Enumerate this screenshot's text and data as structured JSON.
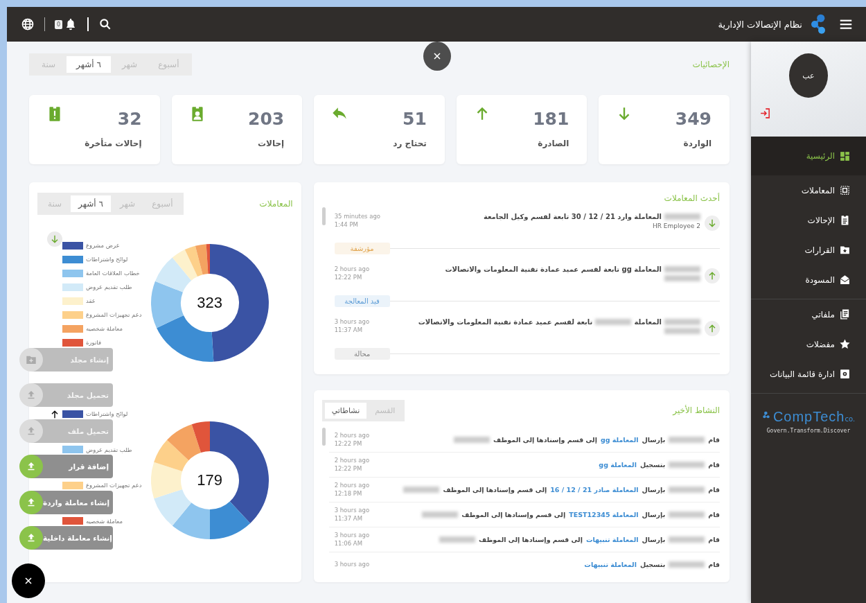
{
  "app": {
    "title": "نظام الإتصالات الإدارية",
    "notification_count": "0"
  },
  "stats": {
    "title": "الإحصائيات",
    "periods": [
      {
        "label": "أسبوع",
        "selected": false
      },
      {
        "label": "شهر",
        "selected": false
      },
      {
        "label": "٦ أشهر",
        "selected": true
      },
      {
        "label": "سنة",
        "selected": false
      }
    ],
    "cards": [
      {
        "kind": "incoming",
        "value": "349",
        "label": "الواردة"
      },
      {
        "kind": "outgoing",
        "value": "181",
        "label": "الصادرة"
      },
      {
        "kind": "reply",
        "value": "51",
        "label": "تحتاج رد"
      },
      {
        "kind": "referral",
        "value": "203",
        "label": "إحالات"
      },
      {
        "kind": "late",
        "value": "32",
        "label": "إحالات متأخرة"
      }
    ]
  },
  "recent": {
    "title": "أحدث المعاملات",
    "items": [
      {
        "kind": "incoming",
        "segments": [
          {
            "kind": "redacted"
          },
          {
            "kind": "text",
            "text": "المعاملة وارد 21 / 12 / 30 تابعة لقسم وكيل الجامعة"
          }
        ],
        "subtitle": {
          "kind": "text",
          "text": "HR Employee 2"
        },
        "ago": "35 minutes ago",
        "time": "1:44 PM",
        "status": "مؤرشفة",
        "color": "#e0a24a"
      },
      {
        "kind": "outgoing",
        "segments": [
          {
            "kind": "redacted"
          },
          {
            "kind": "text",
            "text": "المعاملة gg تابعة لقسم عميد عمادة تقنية المعلومات والاتصالات"
          }
        ],
        "subtitle": {
          "kind": "redacted"
        },
        "ago": "2 hours ago",
        "time": "12:22 PM",
        "status": "قيد المعالجة",
        "color": "#5b9bd5"
      },
      {
        "kind": "outgoing",
        "segments": [
          {
            "kind": "redacted"
          },
          {
            "kind": "text",
            "text": "المعاملة"
          },
          {
            "kind": "redacted"
          },
          {
            "kind": "text",
            "text": "تابعة لقسم عميد عمادة تقنية المعلومات والاتصالات"
          }
        ],
        "subtitle": {
          "kind": "redacted"
        },
        "ago": "3 hours ago",
        "time": "11:37 AM",
        "status": "محالة",
        "color": "#808080"
      }
    ]
  },
  "activity": {
    "title": "النشاط الأخير",
    "tabs": [
      {
        "label": "القسم",
        "selected": false
      },
      {
        "label": "نشاطاتي",
        "selected": true
      }
    ],
    "rows": [
      {
        "segments": [
          {
            "kind": "text",
            "text": "قام"
          },
          {
            "kind": "redacted"
          },
          {
            "kind": "text",
            "text": "بإرسال"
          },
          {
            "kind": "link",
            "text": "المعاملة gg"
          },
          {
            "kind": "text",
            "text": "إلى قسم وإسنادها إلى الموظف"
          },
          {
            "kind": "redacted"
          }
        ],
        "ago": "2 hours ago",
        "time": "12:22 PM"
      },
      {
        "segments": [
          {
            "kind": "text",
            "text": "قام"
          },
          {
            "kind": "redacted"
          },
          {
            "kind": "text",
            "text": "بتسجيل"
          },
          {
            "kind": "link",
            "text": "المعاملة gg"
          }
        ],
        "ago": "2 hours ago",
        "time": "12:22 PM"
      },
      {
        "segments": [
          {
            "kind": "text",
            "text": "قام"
          },
          {
            "kind": "redacted"
          },
          {
            "kind": "text",
            "text": "بإرسال"
          },
          {
            "kind": "link",
            "text": "المعاملة صادر 21 / 12 / 16"
          },
          {
            "kind": "text",
            "text": "إلى قسم وإسنادها إلى الموظف"
          },
          {
            "kind": "redacted"
          }
        ],
        "ago": "2 hours ago",
        "time": "12:18 PM"
      },
      {
        "segments": [
          {
            "kind": "text",
            "text": "قام"
          },
          {
            "kind": "redacted"
          },
          {
            "kind": "text",
            "text": "بإرسال"
          },
          {
            "kind": "link",
            "text": "المعاملة TEST12345"
          },
          {
            "kind": "text",
            "text": "إلى قسم وإسنادها إلى الموظف"
          },
          {
            "kind": "redacted"
          }
        ],
        "ago": "3 hours ago",
        "time": "11:37 AM"
      },
      {
        "segments": [
          {
            "kind": "text",
            "text": "قام"
          },
          {
            "kind": "redacted"
          },
          {
            "kind": "text",
            "text": "بإرسال"
          },
          {
            "kind": "link",
            "text": "المعاملة تنبيهات"
          },
          {
            "kind": "text",
            "text": "إلى قسم وإسنادها إلى الموظف"
          },
          {
            "kind": "redacted"
          }
        ],
        "ago": "3 hours ago",
        "time": "11:06 AM"
      },
      {
        "segments": [
          {
            "kind": "text",
            "text": "قام"
          },
          {
            "kind": "redacted"
          },
          {
            "kind": "text",
            "text": "بتسجيل"
          },
          {
            "kind": "link",
            "text": "المعاملة تنبيهات"
          }
        ],
        "ago": "3 hours ago"
      }
    ]
  },
  "charts": {
    "title": "المعاملات",
    "periods": [
      {
        "label": "أسبوع",
        "selected": false
      },
      {
        "label": "شهر",
        "selected": false
      },
      {
        "label": "٦ أشهر",
        "selected": true
      },
      {
        "label": "سنة",
        "selected": false
      }
    ],
    "donuts": [
      {
        "kind": "download",
        "total": "323",
        "legend": [
          {
            "label": "عرض مشروع",
            "color": "#3a53a4"
          },
          {
            "label": "لوائح واشتراطات",
            "color": "#3d8dd3"
          },
          {
            "label": "خطاب العلاقات العامة",
            "color": "#8ec5ee"
          },
          {
            "label": "طلب تقديم عروض",
            "color": "#d2eaf8"
          },
          {
            "label": "عقد",
            "color": "#fdf1cc"
          },
          {
            "label": "دعم تجهيزات المشروع",
            "color": "#fdd08a"
          },
          {
            "label": "معاملة شخصيه",
            "color": "#f4a361"
          },
          {
            "label": "فاتورة",
            "color": "#e0553b"
          }
        ]
      },
      {
        "kind": "upload",
        "total": "179",
        "legend": [
          {
            "label": "لوائح واشتراطات",
            "color": "#3a53a4"
          },
          {
            "label": "طلب تقديم عروض",
            "color": "#8ec5ee"
          },
          {
            "label": "دعم تجهيزات المشروع",
            "color": "#fdd08a"
          },
          {
            "label": "معاملة شخصيه",
            "color": "#e0553b"
          }
        ]
      }
    ]
  },
  "actions": [
    {
      "kind": "folder",
      "label": "إنشاء مجلد",
      "disabled": true
    },
    {
      "kind": "upload",
      "label": "تحميل مجلد",
      "disabled": true
    },
    {
      "kind": "upload",
      "label": "تحميل ملف",
      "disabled": true
    },
    {
      "kind": "upload",
      "label": "إضافة قرار",
      "disabled": false
    },
    {
      "kind": "upload",
      "label": "إنشاء معاملة واردة",
      "disabled": false
    },
    {
      "kind": "upload",
      "label": "إنشاء معاملة داخلية",
      "disabled": false
    }
  ],
  "sidebar": {
    "avatar_initials": "عب",
    "groups": [
      {
        "items": [
          {
            "kind": "dashboard",
            "label": "الرئيسية",
            "selected": true
          },
          {
            "kind": "transactions",
            "label": "المعاملات",
            "selected": false
          },
          {
            "kind": "referrals",
            "label": "الإحالات",
            "selected": false
          },
          {
            "kind": "decisions",
            "label": "القرارات",
            "selected": false
          },
          {
            "kind": "drafts",
            "label": "المسودة",
            "selected": false
          }
        ]
      },
      {
        "items": [
          {
            "kind": "files",
            "label": "ملفاتي",
            "selected": false
          },
          {
            "kind": "favorites",
            "label": "مفضلات",
            "selected": false
          },
          {
            "kind": "settings",
            "label": "ادارة قائمة البيانات",
            "selected": false
          }
        ]
      }
    ],
    "brand": {
      "name": "CompTech",
      "suffix": "co.",
      "tagline": "Govern.Transform.Discover"
    }
  }
}
